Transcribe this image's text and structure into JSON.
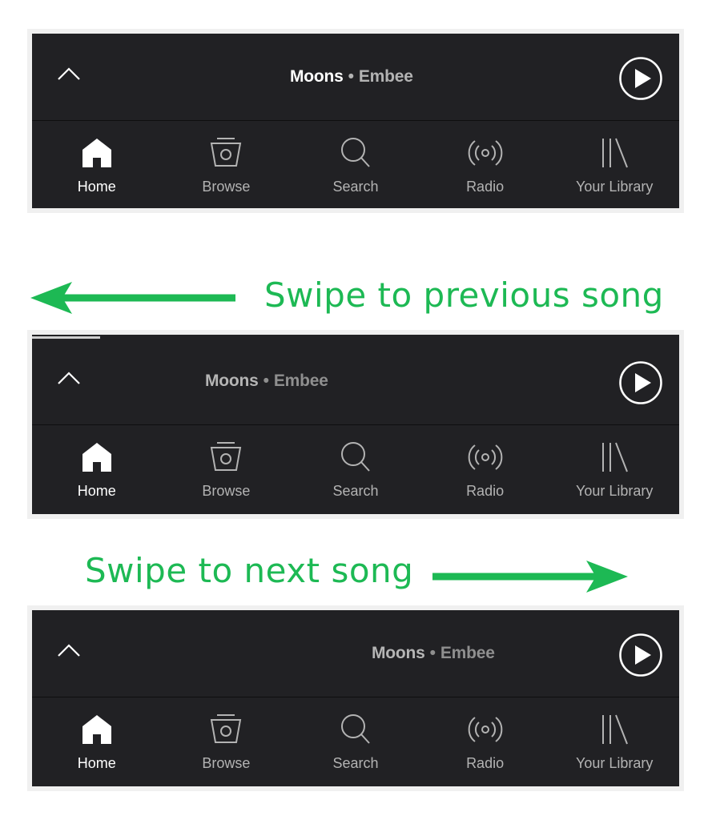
{
  "captions": {
    "previous": "Swipe to previous song",
    "next": "Swipe to next song"
  },
  "colors": {
    "caption_green": "#1db954",
    "bar_background": "#212124",
    "active_label": "#ffffff",
    "inactive_label": "#b3b3b3"
  },
  "panels": [
    {
      "now_playing": {
        "song": "Moons",
        "separator": "•",
        "artist": "Embee"
      },
      "nav": [
        {
          "label": "Home",
          "icon": "home-icon",
          "active": true
        },
        {
          "label": "Browse",
          "icon": "browse-icon",
          "active": false
        },
        {
          "label": "Search",
          "icon": "search-icon",
          "active": false
        },
        {
          "label": "Radio",
          "icon": "radio-icon",
          "active": false
        },
        {
          "label": "Your Library",
          "icon": "library-icon",
          "active": false
        }
      ]
    },
    {
      "now_playing": {
        "song": "Moons",
        "separator": "•",
        "artist": "Embee"
      },
      "nav": [
        {
          "label": "Home",
          "icon": "home-icon",
          "active": true
        },
        {
          "label": "Browse",
          "icon": "browse-icon",
          "active": false
        },
        {
          "label": "Search",
          "icon": "search-icon",
          "active": false
        },
        {
          "label": "Radio",
          "icon": "radio-icon",
          "active": false
        },
        {
          "label": "Your Library",
          "icon": "library-icon",
          "active": false
        }
      ]
    },
    {
      "now_playing": {
        "song": "Moons",
        "separator": "•",
        "artist": "Embee"
      },
      "nav": [
        {
          "label": "Home",
          "icon": "home-icon",
          "active": true
        },
        {
          "label": "Browse",
          "icon": "browse-icon",
          "active": false
        },
        {
          "label": "Search",
          "icon": "search-icon",
          "active": false
        },
        {
          "label": "Radio",
          "icon": "radio-icon",
          "active": false
        },
        {
          "label": "Your Library",
          "icon": "library-icon",
          "active": false
        }
      ]
    }
  ]
}
